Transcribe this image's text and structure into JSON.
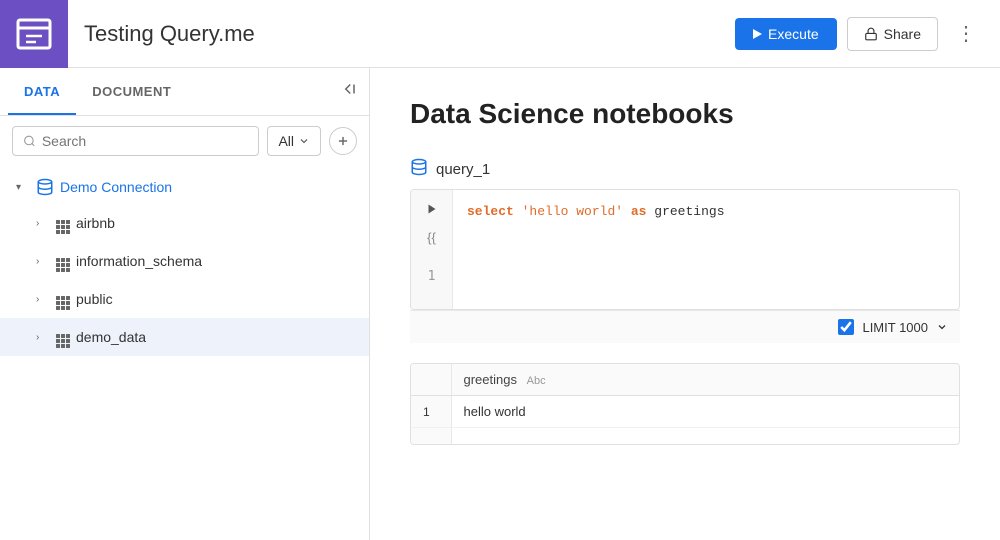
{
  "header": {
    "title": "Testing Query.me",
    "execute_label": "Execute",
    "share_label": "Share",
    "more_label": "⋮"
  },
  "sidebar": {
    "tab_data": "DATA",
    "tab_document": "DOCUMENT",
    "search_placeholder": "Search",
    "search_filter": "All",
    "connection": {
      "name": "Demo Connection",
      "schemas": [
        {
          "name": "airbnb"
        },
        {
          "name": "information_schema"
        },
        {
          "name": "public"
        },
        {
          "name": "demo_data",
          "selected": true
        }
      ]
    }
  },
  "content": {
    "title": "Data Science notebooks",
    "query": {
      "name": "query_1",
      "line_number": "1",
      "code_keyword": "select",
      "code_string": "'hello world'",
      "code_as": "as",
      "code_field": "greetings",
      "limit_checked": true,
      "limit_label": "LIMIT 1000"
    },
    "results": {
      "columns": [
        {
          "name": "greetings",
          "type": "Abc"
        }
      ],
      "rows": [
        {
          "num": "1",
          "greetings": "hello world"
        }
      ]
    }
  },
  "icons": {
    "book": "📖",
    "database": "🗄",
    "search": "🔍",
    "play": "▶",
    "lock": "🔒",
    "chevron_down": "▾",
    "chevron_right": "›",
    "collapse": "⇤",
    "plus": "+"
  }
}
